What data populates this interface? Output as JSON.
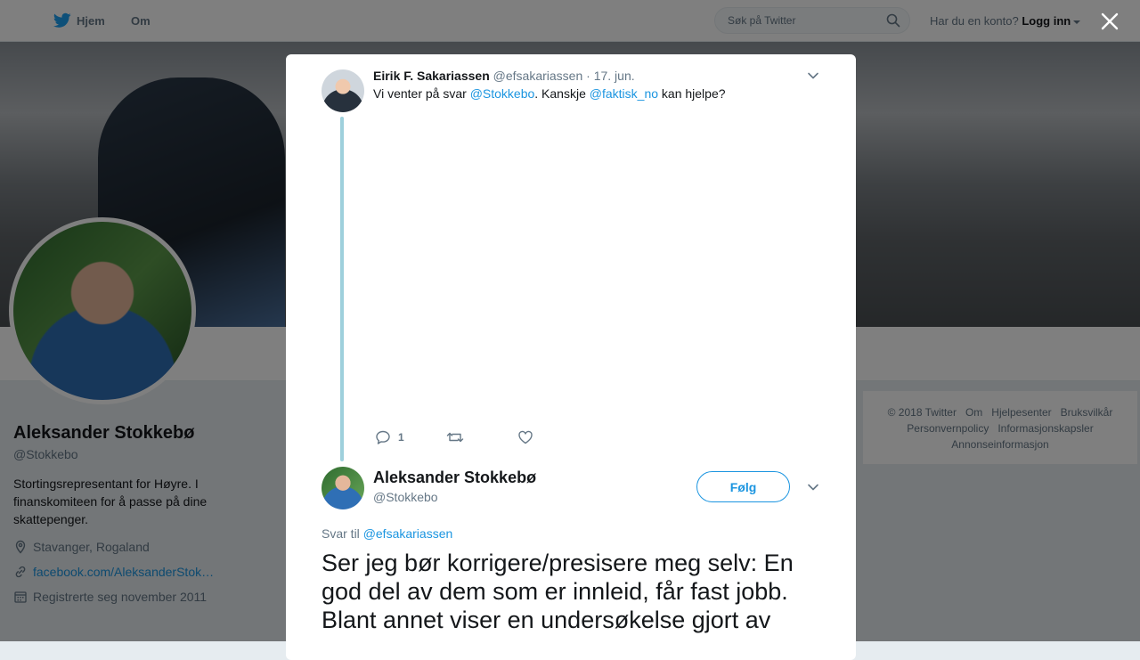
{
  "topnav": {
    "home_label": "Hjem",
    "about_label": "Om",
    "search_placeholder": "Søk på Twitter",
    "account_question": "Har du en konto?",
    "login_label": "Logg inn"
  },
  "profile": {
    "name": "Aleksander Stokkebø",
    "handle": "@Stokkebo",
    "bio": "Stortingsrepresentant for Høyre. I finanskomiteen for å passe på dine skattepenger.",
    "location": "Stavanger, Rogaland",
    "url": "facebook.com/AleksanderStok…",
    "joined": "Registrerte seg november 2011"
  },
  "footer": {
    "links": [
      "© 2018 Twitter",
      "Om",
      "Hjelpesenter",
      "Bruksvilkår",
      "Personvernpolicy",
      "Informasjonskapsler",
      "Annonseinformasjon"
    ]
  },
  "modal": {
    "tweet1": {
      "name": "Eirik F. Sakariassen",
      "handle": "@efsakariassen",
      "dot": " · ",
      "time": "17. jun.",
      "text_part1": "Vi venter på svar ",
      "mention1": "@Stokkebo",
      "text_part2": ". Kanskje ",
      "mention2": "@faktisk_no",
      "text_part3": " kan hjelpe?",
      "reply_count": "1"
    },
    "tweet2": {
      "name": "Aleksander Stokkebø",
      "handle": "@Stokkebo",
      "follow_label": "Følg",
      "reply_to_label": "Svar til ",
      "reply_to_handle": "@efsakariassen",
      "text": "Ser jeg bør korrigere/presisere meg selv: En god del av dem som er innleid, får fast jobb. Blant annet viser en undersøkelse gjort av"
    }
  },
  "colors": {
    "accent": "#1b95e0",
    "thread_line": "#9ed0dc"
  }
}
